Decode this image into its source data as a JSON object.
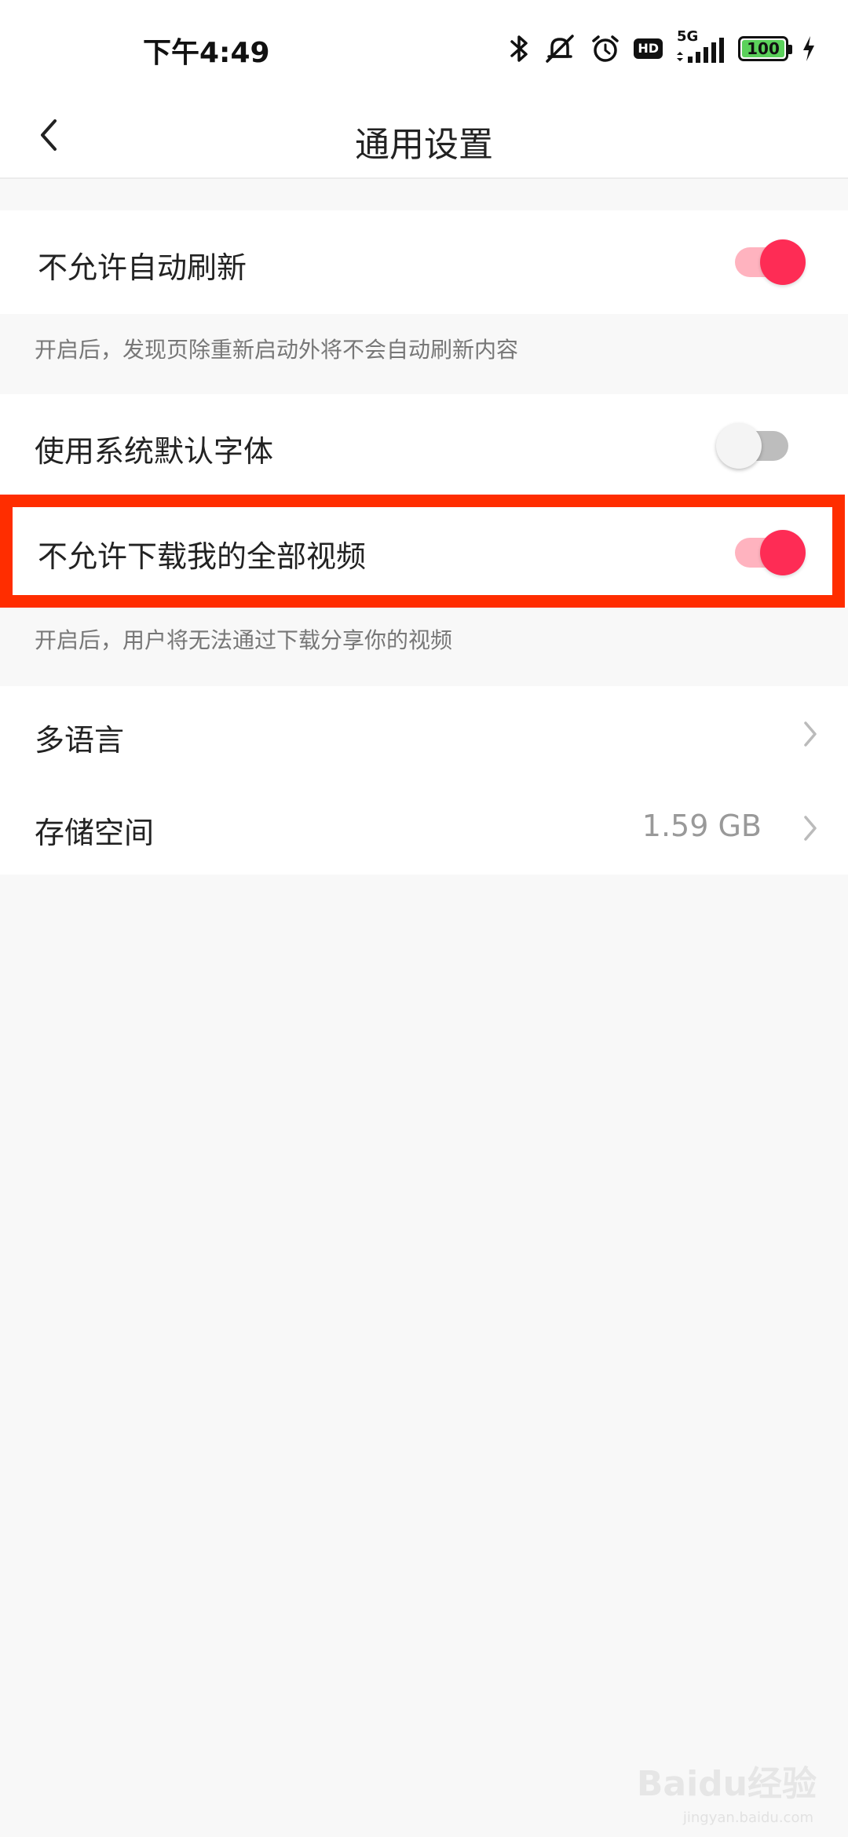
{
  "status_bar": {
    "time": "下午4:49",
    "network": "5G",
    "hd": "HD",
    "battery": "100",
    "battery_level_percent": 100,
    "icons": [
      "bluetooth-icon",
      "mute-icon",
      "alarm-icon",
      "hd-icon",
      "signal-icon",
      "battery-icon",
      "charging-icon"
    ]
  },
  "nav": {
    "title": "通用设置",
    "back_icon": "chevron-left-icon"
  },
  "settings": {
    "auto_refresh": {
      "label": "不允许自动刷新",
      "enabled": true,
      "description": "开启后，发现页除重新启动外将不会自动刷新内容"
    },
    "system_font": {
      "label": "使用系统默认字体",
      "enabled": false
    },
    "download_videos": {
      "label": "不允许下载我的全部视频",
      "enabled": true,
      "description": "开启后，用户将无法通过下载分享你的视频"
    },
    "language": {
      "label": "多语言"
    },
    "storage": {
      "label": "存储空间",
      "value": "1.59 GB"
    }
  },
  "colors": {
    "accent": "#fe2c55",
    "toggle_track_on": "#ffb3bf",
    "highlight_border": "#ff2d00"
  },
  "watermark": {
    "text": "Baidu经验",
    "subtext": "jingyan.baidu.com"
  }
}
